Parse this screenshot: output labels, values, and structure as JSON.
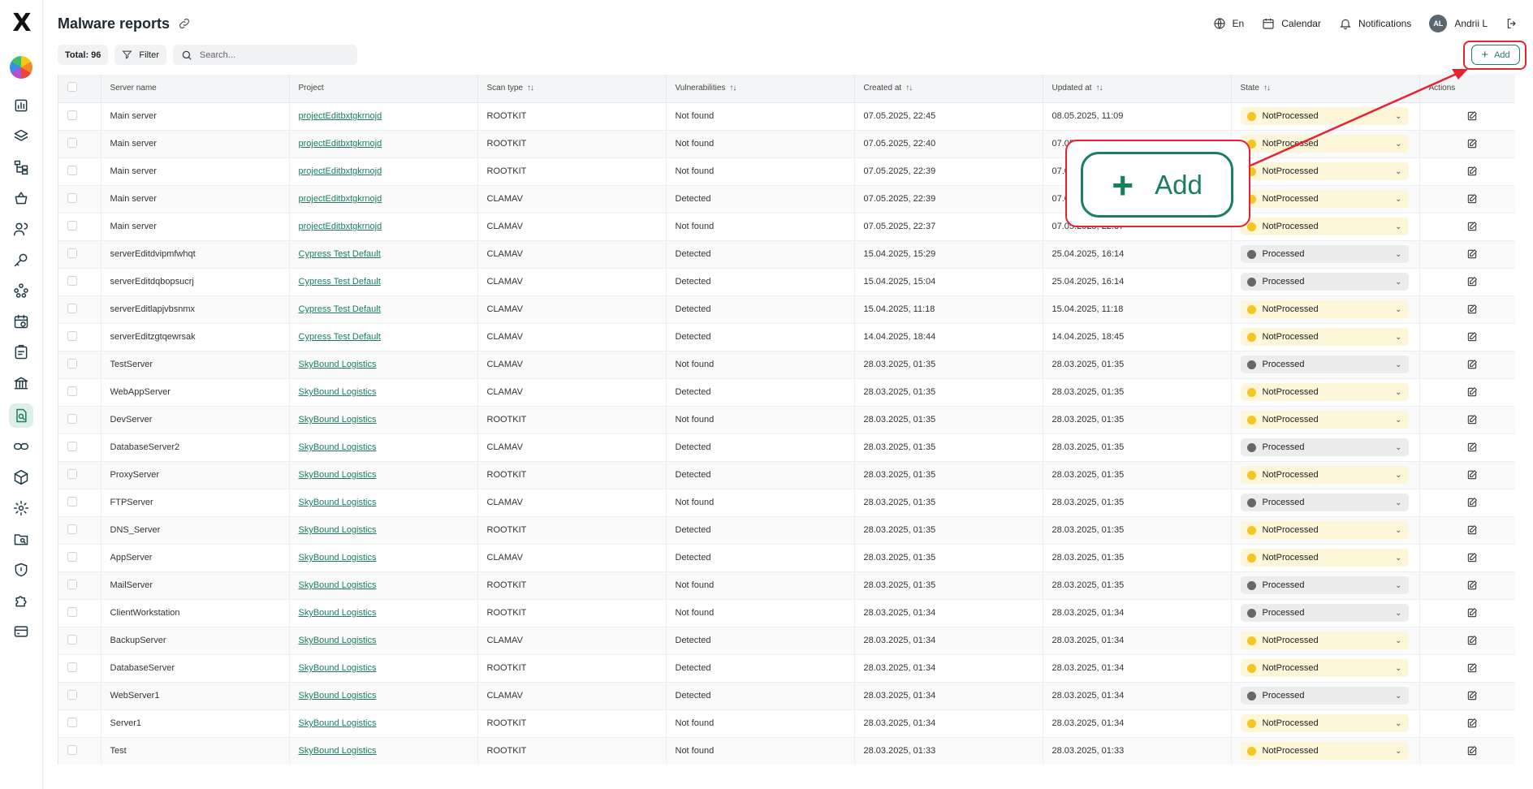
{
  "page": {
    "title": "Malware reports"
  },
  "header": {
    "language": "En",
    "calendar": "Calendar",
    "notifications": "Notifications",
    "user_initials": "AL",
    "user_name": "Andrii L"
  },
  "toolbar": {
    "total": "Total: 96",
    "filter": "Filter",
    "search_placeholder": "Search...",
    "add": "Add"
  },
  "table": {
    "columns": [
      "Server name",
      "Project",
      "Scan type",
      "Vulnerabilities",
      "Created at",
      "Updated at",
      "State",
      "Actions"
    ],
    "rows": [
      [
        "Main server",
        "projectEditbxtgkrnojd",
        "ROOTKIT",
        "Not found",
        "07.05.2025, 22:45",
        "08.05.2025, 11:09",
        "NotProcessed"
      ],
      [
        "Main server",
        "projectEditbxtgkrnojd",
        "ROOTKIT",
        "Not found",
        "07.05.2025, 22:40",
        "07.05.2025, 22:40",
        "NotProcessed"
      ],
      [
        "Main server",
        "projectEditbxtgkrnojd",
        "ROOTKIT",
        "Not found",
        "07.05.2025, 22:39",
        "07.05.2025, 22:39",
        "NotProcessed"
      ],
      [
        "Main server",
        "projectEditbxtgkrnojd",
        "CLAMAV",
        "Detected",
        "07.05.2025, 22:39",
        "07.05.2025, 22:39",
        "NotProcessed"
      ],
      [
        "Main server",
        "projectEditbxtgkrnojd",
        "CLAMAV",
        "Not found",
        "07.05.2025, 22:37",
        "07.05.2025, 22:37",
        "NotProcessed"
      ],
      [
        "serverEditdvipmfwhqt",
        "Cypress Test Default",
        "CLAMAV",
        "Detected",
        "15.04.2025, 15:29",
        "25.04.2025, 16:14",
        "Processed"
      ],
      [
        "serverEditdqbopsucrj",
        "Cypress Test Default",
        "CLAMAV",
        "Detected",
        "15.04.2025, 15:04",
        "25.04.2025, 16:14",
        "Processed"
      ],
      [
        "serverEditlapjvbsnmx",
        "Cypress Test Default",
        "CLAMAV",
        "Detected",
        "15.04.2025, 11:18",
        "15.04.2025, 11:18",
        "NotProcessed"
      ],
      [
        "serverEditzgtqewrsak",
        "Cypress Test Default",
        "CLAMAV",
        "Detected",
        "14.04.2025, 18:44",
        "14.04.2025, 18:45",
        "NotProcessed"
      ],
      [
        "TestServer",
        "SkyBound Logistics",
        "CLAMAV",
        "Not found",
        "28.03.2025, 01:35",
        "28.03.2025, 01:35",
        "Processed"
      ],
      [
        "WebAppServer",
        "SkyBound Logistics",
        "CLAMAV",
        "Detected",
        "28.03.2025, 01:35",
        "28.03.2025, 01:35",
        "NotProcessed"
      ],
      [
        "DevServer",
        "SkyBound Logistics",
        "ROOTKIT",
        "Not found",
        "28.03.2025, 01:35",
        "28.03.2025, 01:35",
        "NotProcessed"
      ],
      [
        "DatabaseServer2",
        "SkyBound Logistics",
        "CLAMAV",
        "Detected",
        "28.03.2025, 01:35",
        "28.03.2025, 01:35",
        "Processed"
      ],
      [
        "ProxyServer",
        "SkyBound Logistics",
        "ROOTKIT",
        "Detected",
        "28.03.2025, 01:35",
        "28.03.2025, 01:35",
        "NotProcessed"
      ],
      [
        "FTPServer",
        "SkyBound Logistics",
        "CLAMAV",
        "Not found",
        "28.03.2025, 01:35",
        "28.03.2025, 01:35",
        "Processed"
      ],
      [
        "DNS_Server",
        "SkyBound Logistics",
        "ROOTKIT",
        "Detected",
        "28.03.2025, 01:35",
        "28.03.2025, 01:35",
        "NotProcessed"
      ],
      [
        "AppServer",
        "SkyBound Logistics",
        "CLAMAV",
        "Detected",
        "28.03.2025, 01:35",
        "28.03.2025, 01:35",
        "NotProcessed"
      ],
      [
        "MailServer",
        "SkyBound Logistics",
        "ROOTKIT",
        "Not found",
        "28.03.2025, 01:35",
        "28.03.2025, 01:35",
        "Processed"
      ],
      [
        "ClientWorkstation",
        "SkyBound Logistics",
        "ROOTKIT",
        "Not found",
        "28.03.2025, 01:34",
        "28.03.2025, 01:34",
        "Processed"
      ],
      [
        "BackupServer",
        "SkyBound Logistics",
        "CLAMAV",
        "Detected",
        "28.03.2025, 01:34",
        "28.03.2025, 01:34",
        "NotProcessed"
      ],
      [
        "DatabaseServer",
        "SkyBound Logistics",
        "ROOTKIT",
        "Detected",
        "28.03.2025, 01:34",
        "28.03.2025, 01:34",
        "NotProcessed"
      ],
      [
        "WebServer1",
        "SkyBound Logistics",
        "CLAMAV",
        "Detected",
        "28.03.2025, 01:34",
        "28.03.2025, 01:34",
        "Processed"
      ],
      [
        "Server1",
        "SkyBound Logistics",
        "ROOTKIT",
        "Not found",
        "28.03.2025, 01:34",
        "28.03.2025, 01:34",
        "NotProcessed"
      ],
      [
        "Test",
        "SkyBound Logistics",
        "ROOTKIT",
        "Not found",
        "28.03.2025, 01:33",
        "28.03.2025, 01:33",
        "NotProcessed"
      ]
    ]
  },
  "annotation": {
    "zoom_label": "Add",
    "color": "#e8232f"
  },
  "colors": {
    "accent": "#1a7f5c",
    "not_processed_dot": "#f3c623",
    "processed_dot": "#666666"
  },
  "sidebar": {
    "icons": [
      "logo-icon",
      "color-wheel-icon",
      "bar-chart-icon",
      "layers-icon",
      "hierarchy-icon",
      "basket-icon",
      "users-icon",
      "key-icon",
      "network-icon",
      "calendar-check-icon",
      "clipboard-icon",
      "bank-icon",
      "malware-report-icon",
      "link-icon",
      "cube-icon",
      "settings-icon",
      "folder-search-icon",
      "shield-icon",
      "puzzle-icon",
      "storage-icon"
    ]
  }
}
